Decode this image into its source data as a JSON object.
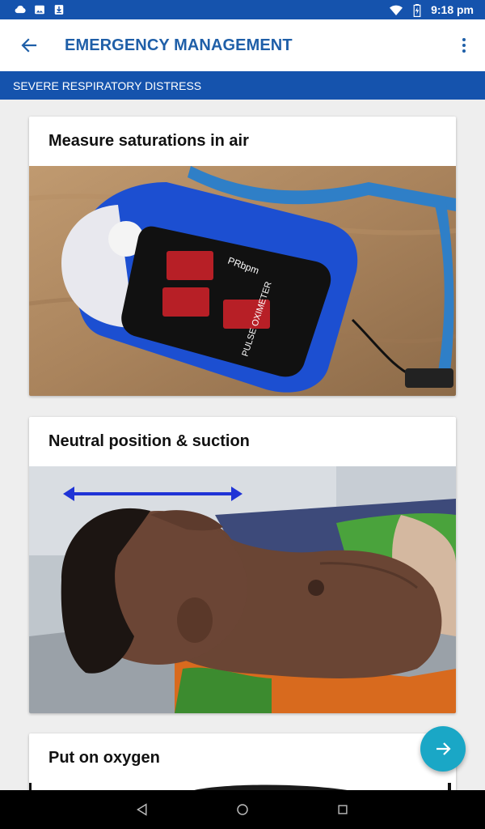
{
  "status_bar": {
    "time": "9:18 pm",
    "left_icons": [
      "cloud-icon",
      "image-icon",
      "download-icon"
    ],
    "right_icons": [
      "wifi-icon",
      "battery-icon"
    ]
  },
  "app_bar": {
    "title": "EMERGENCY MANAGEMENT",
    "back_icon": "arrow-back-icon",
    "menu_icon": "more-vert-icon"
  },
  "section": {
    "title": "SEVERE RESPIRATORY DISTRESS"
  },
  "cards": [
    {
      "title": "Measure saturations in air",
      "image": "pulse-oximeter-photo"
    },
    {
      "title": "Neutral position & suction",
      "image": "infant-neutral-position-photo"
    },
    {
      "title": "Put on oxygen",
      "image": "oxygen-photo"
    }
  ],
  "fab": {
    "icon": "arrow-forward-icon"
  },
  "colors": {
    "primary": "#1553ad",
    "title_text": "#1f5fa8",
    "fab": "#1aa7c6"
  }
}
